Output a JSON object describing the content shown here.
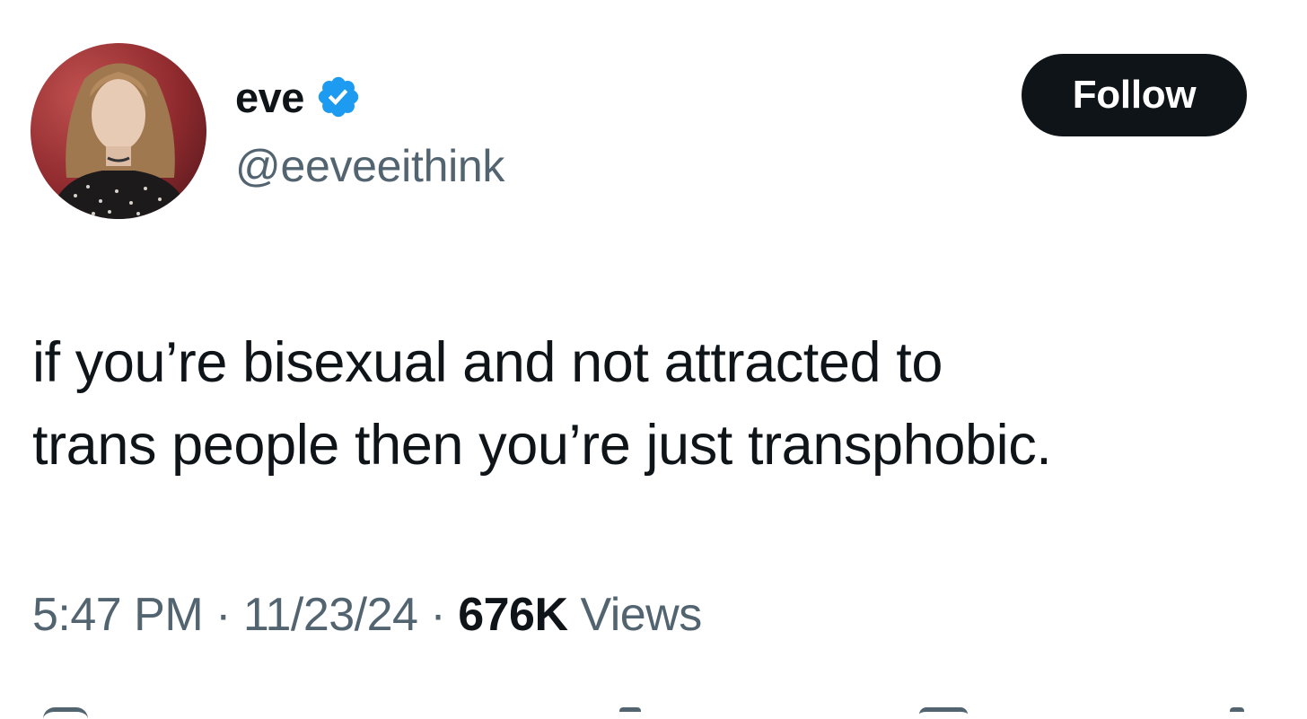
{
  "tweet": {
    "author": {
      "display_name": "eve",
      "handle": "@eeveeithink",
      "verified": true,
      "verified_color": "#1d9bf0"
    },
    "follow_label": "Follow",
    "text_lines": [
      "if you’re bisexual and not attracted to",
      "trans people then you’re just transphobic."
    ],
    "time": "5:47 PM",
    "separator": "·",
    "date": "11/23/24",
    "views_count": "676K",
    "views_label": "Views"
  },
  "colors": {
    "text_primary": "#0f1419",
    "text_secondary": "#536471",
    "follow_bg": "#0f1419",
    "follow_text": "#ffffff"
  },
  "icons": [
    "verified-badge-icon",
    "reply-icon",
    "repost-icon",
    "like-icon",
    "bookmark-icon",
    "share-icon"
  ]
}
